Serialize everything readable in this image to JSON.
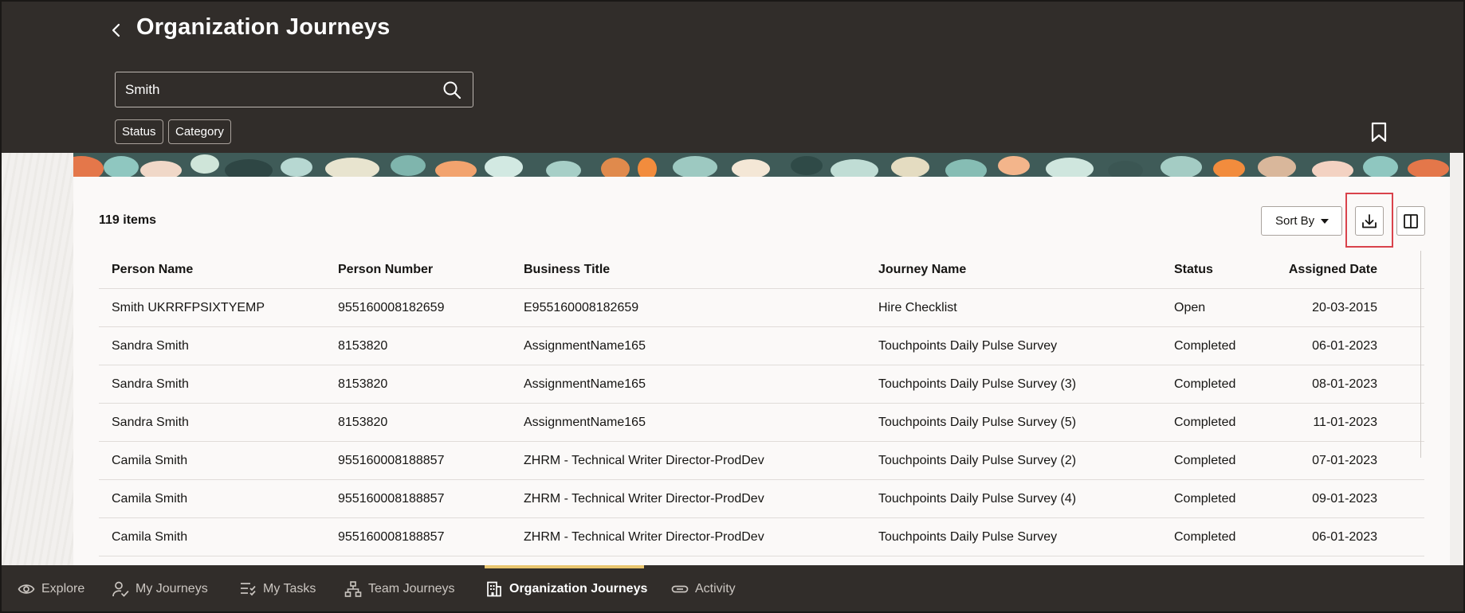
{
  "header": {
    "title": "Organization Journeys",
    "search": {
      "value": "Smith",
      "placeholder": ""
    },
    "filters": [
      "Status",
      "Category"
    ]
  },
  "toolbar": {
    "items_count": "119 items",
    "sort_label": "Sort By"
  },
  "table": {
    "columns": [
      "Person Name",
      "Person Number",
      "Business Title",
      "Journey Name",
      "Status",
      "Assigned Date"
    ],
    "rows": [
      [
        "Smith UKRRFPSIXTYEMP",
        "955160008182659",
        "E955160008182659",
        "Hire Checklist",
        "Open",
        "20-03-2015"
      ],
      [
        "Sandra Smith",
        "8153820",
        "AssignmentName165",
        "Touchpoints Daily Pulse Survey",
        "Completed",
        "06-01-2023"
      ],
      [
        "Sandra Smith",
        "8153820",
        "AssignmentName165",
        "Touchpoints Daily Pulse Survey (3)",
        "Completed",
        "08-01-2023"
      ],
      [
        "Sandra Smith",
        "8153820",
        "AssignmentName165",
        "Touchpoints Daily Pulse Survey (5)",
        "Completed",
        "11-01-2023"
      ],
      [
        "Camila Smith",
        "955160008188857",
        "ZHRM - Technical Writer Director-ProdDev",
        "Touchpoints Daily Pulse Survey (2)",
        "Completed",
        "07-01-2023"
      ],
      [
        "Camila Smith",
        "955160008188857",
        "ZHRM - Technical Writer Director-ProdDev",
        "Touchpoints Daily Pulse Survey (4)",
        "Completed",
        "09-01-2023"
      ],
      [
        "Camila Smith",
        "955160008188857",
        "ZHRM - Technical Writer Director-ProdDev",
        "Touchpoints Daily Pulse Survey",
        "Completed",
        "06-01-2023"
      ]
    ]
  },
  "bottom_nav": {
    "items": [
      {
        "label": "Explore",
        "icon": "eye-icon"
      },
      {
        "label": "My Journeys",
        "icon": "person-check-icon"
      },
      {
        "label": "My Tasks",
        "icon": "checklist-icon"
      },
      {
        "label": "Team Journeys",
        "icon": "org-chart-icon"
      },
      {
        "label": "Organization Journeys",
        "icon": "building-icon",
        "active": true
      },
      {
        "label": "Activity",
        "icon": "link-icon"
      }
    ]
  },
  "colors": {
    "header_bg": "#312d2a",
    "active_indicator": "#e9c66f",
    "highlight": "#d9434c"
  }
}
